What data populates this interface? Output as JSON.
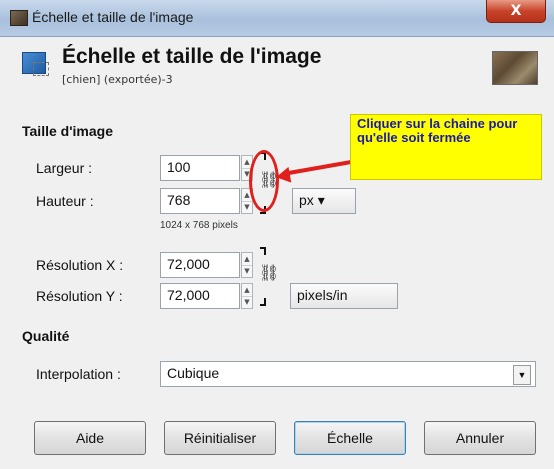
{
  "window": {
    "title": "Échelle et taille de l'image",
    "close_label": "X"
  },
  "header": {
    "title": "Échelle et taille de l'image",
    "subtitle": "[chien] (exportée)-3"
  },
  "image_size": {
    "section_title": "Taille d'image",
    "width_label": "Largeur :",
    "width_value": "100",
    "height_label": "Hauteur :",
    "height_value": "768",
    "unit": "px",
    "pixel_info": "1024 x 768 pixels",
    "res_x_label": "Résolution X :",
    "res_x_value": "72,000",
    "res_y_label": "Résolution Y :",
    "res_y_value": "72,000",
    "res_unit": "pixels/in"
  },
  "annotation": {
    "callout_text": "Cliquer sur la chaine pour qu'elle soit fermée"
  },
  "quality": {
    "section_title": "Qualité",
    "interpolation_label": "Interpolation :",
    "interpolation_value": "Cubique"
  },
  "buttons": {
    "help": "Aide",
    "reset": "Réinitialiser",
    "scale": "Échelle",
    "cancel": "Annuler"
  },
  "colors": {
    "callout_bg": "#ffff00",
    "annotation_red": "#e0201c",
    "callout_text": "#1a1aaa"
  }
}
